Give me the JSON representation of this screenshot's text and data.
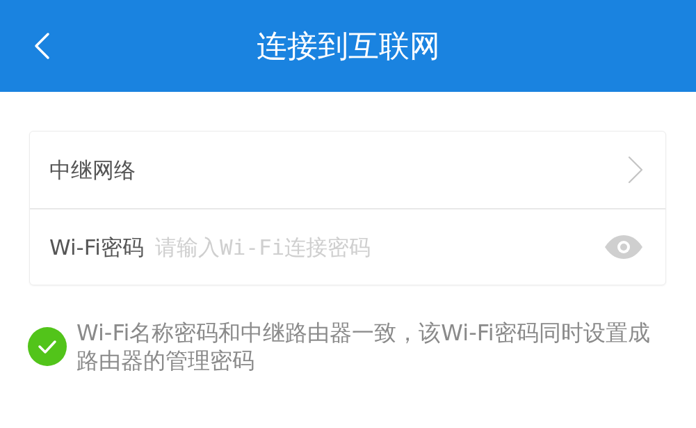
{
  "header": {
    "title": "连接到互联网"
  },
  "form": {
    "rows": [
      {
        "kind": "link",
        "label": "中继网络"
      },
      {
        "kind": "password",
        "label": "Wi-Fi密码",
        "placeholder": "请输入Wi-Fi连接密码"
      }
    ]
  },
  "note": {
    "text": "Wi-Fi名称密码和中继路由器一致，该Wi-Fi密码同时设置成路由器的管理密码"
  }
}
